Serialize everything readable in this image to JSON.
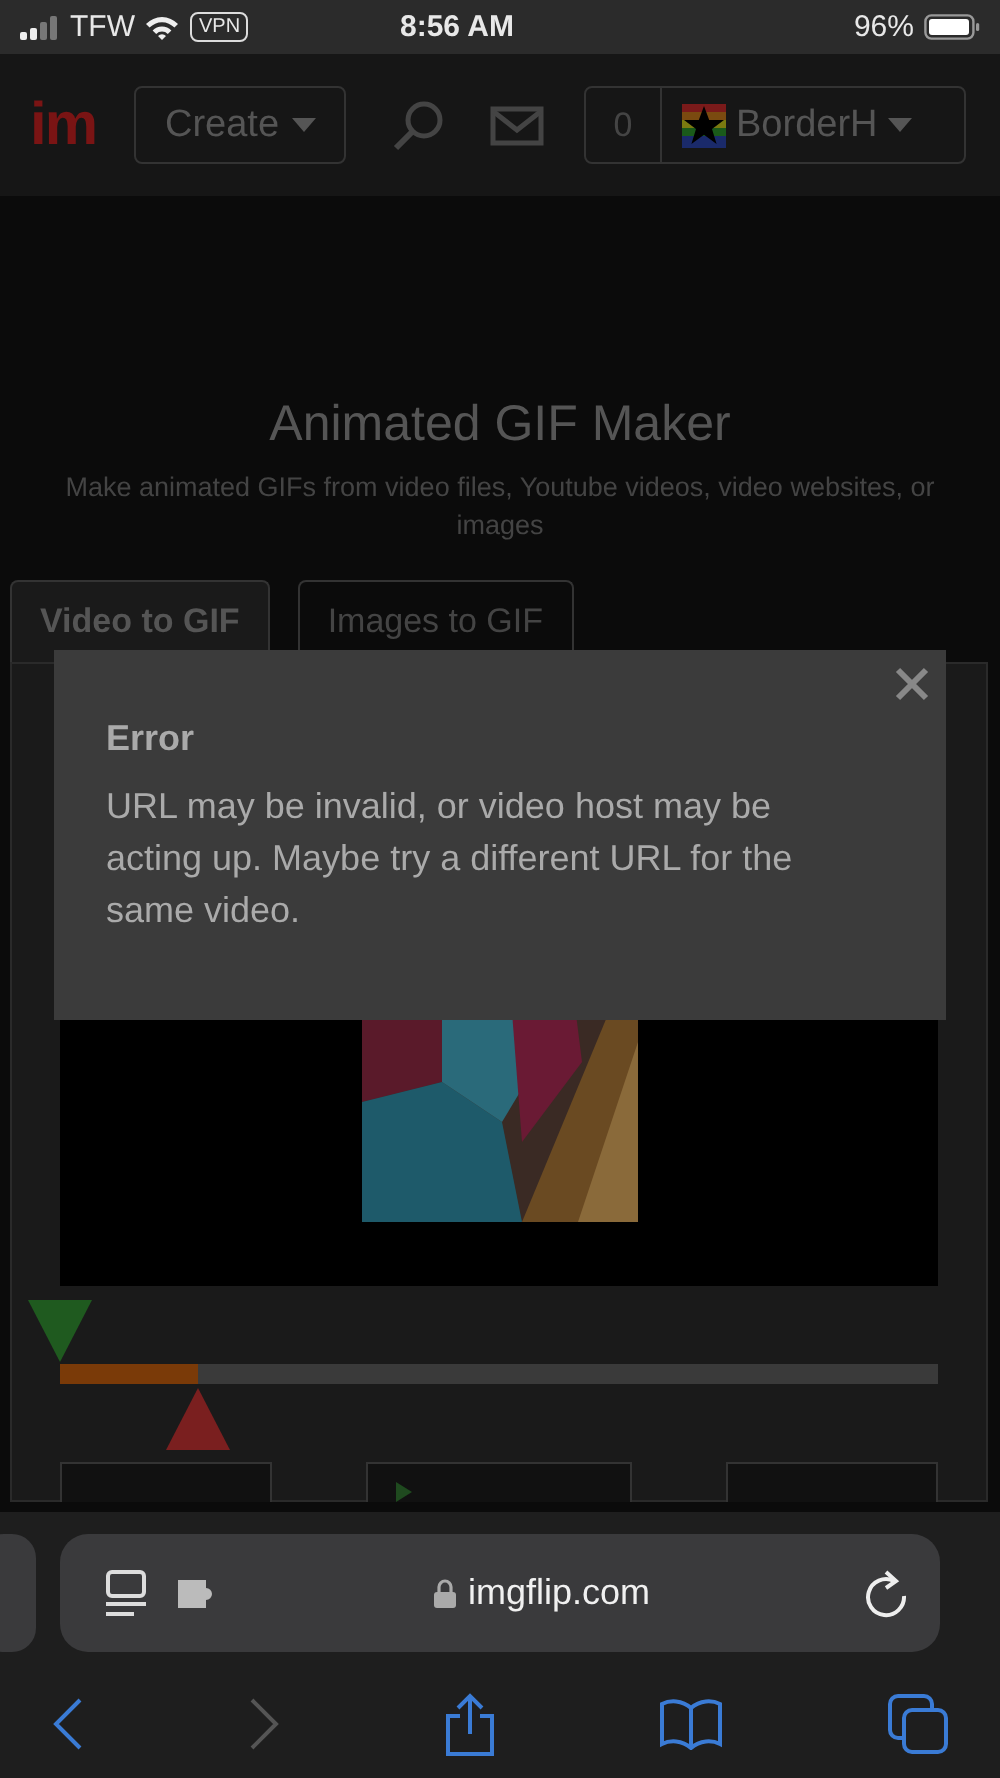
{
  "status_bar": {
    "carrier": "TFW",
    "vpn": "VPN",
    "time": "8:56 AM",
    "battery": "96%"
  },
  "nav": {
    "logo": "im",
    "create": "Create",
    "notifications": "0",
    "user": "BorderH"
  },
  "page": {
    "title": "Animated GIF Maker",
    "subtitle": "Make animated GIFs from video files, Youtube videos, video websites, or images"
  },
  "tabs": [
    {
      "label": "Video to GIF",
      "selected": true
    },
    {
      "label": "Images to GIF",
      "selected": false
    }
  ],
  "trim": {
    "start": {
      "level": 0
    },
    "end": {
      "level": 0.157
    }
  },
  "dialog": {
    "title": "Error",
    "message": "URL may be invalid, or video host may be acting up. Maybe try a different URL for the same video."
  },
  "browser": {
    "url": "imgflip.com",
    "back": {
      "disabled": false
    },
    "forward": {
      "disabled": true
    }
  }
}
